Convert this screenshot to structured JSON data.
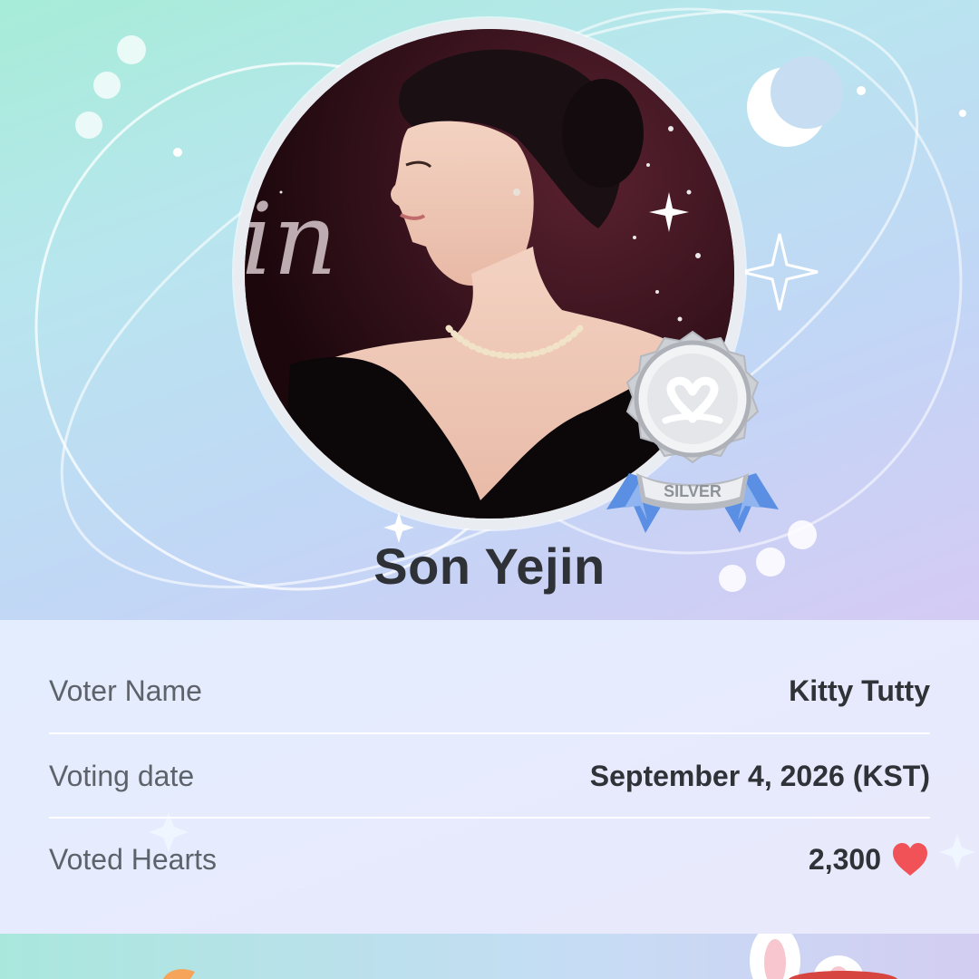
{
  "artist": {
    "name": "Son Yejin",
    "photo_script_text": "in"
  },
  "badge": {
    "tier_label": "SILVER"
  },
  "info": {
    "voter_name_label": "Voter Name",
    "voter_name_value": "Kitty Tutty",
    "voting_date_label": "Voting date",
    "voting_date_value": "September 4, 2026 (KST)",
    "voted_hearts_label": "Voted Hearts",
    "voted_hearts_value": "2,300"
  },
  "colors": {
    "heart": "#f05258",
    "badge_silver": "#c9ccd1",
    "ribbon_blue": "#5a8fe3"
  },
  "icons": {
    "heart": "heart-icon",
    "moon": "crescent-moon-icon",
    "sparkle": "sparkle-icon",
    "medal": "silver-medal-icon"
  }
}
